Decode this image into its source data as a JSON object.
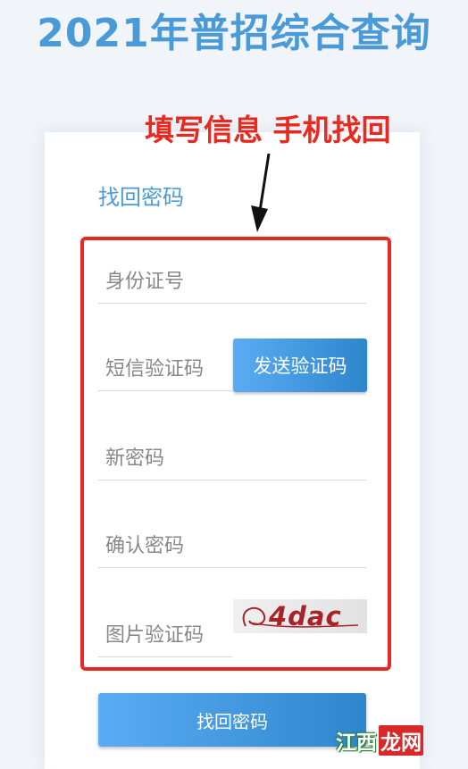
{
  "header": {
    "title": "2021年普招综合查询"
  },
  "annotation": {
    "text": "填写信息 手机找回",
    "color": "#e8291f"
  },
  "card": {
    "heading": "找回密码"
  },
  "form": {
    "id_number_placeholder": "身份证号",
    "sms_code_placeholder": "短信验证码",
    "send_code_label": "发送验证码",
    "new_password_placeholder": "新密码",
    "confirm_password_placeholder": "确认密码",
    "image_code_placeholder": "图片验证码",
    "captcha_text": "4dac",
    "submit_label": "找回密码"
  },
  "watermark": {
    "part1": "江西",
    "part2": "龙网"
  },
  "colors": {
    "accent": "#4a9ad8",
    "button": "#3b94dd",
    "highlight": "#e8291f"
  }
}
